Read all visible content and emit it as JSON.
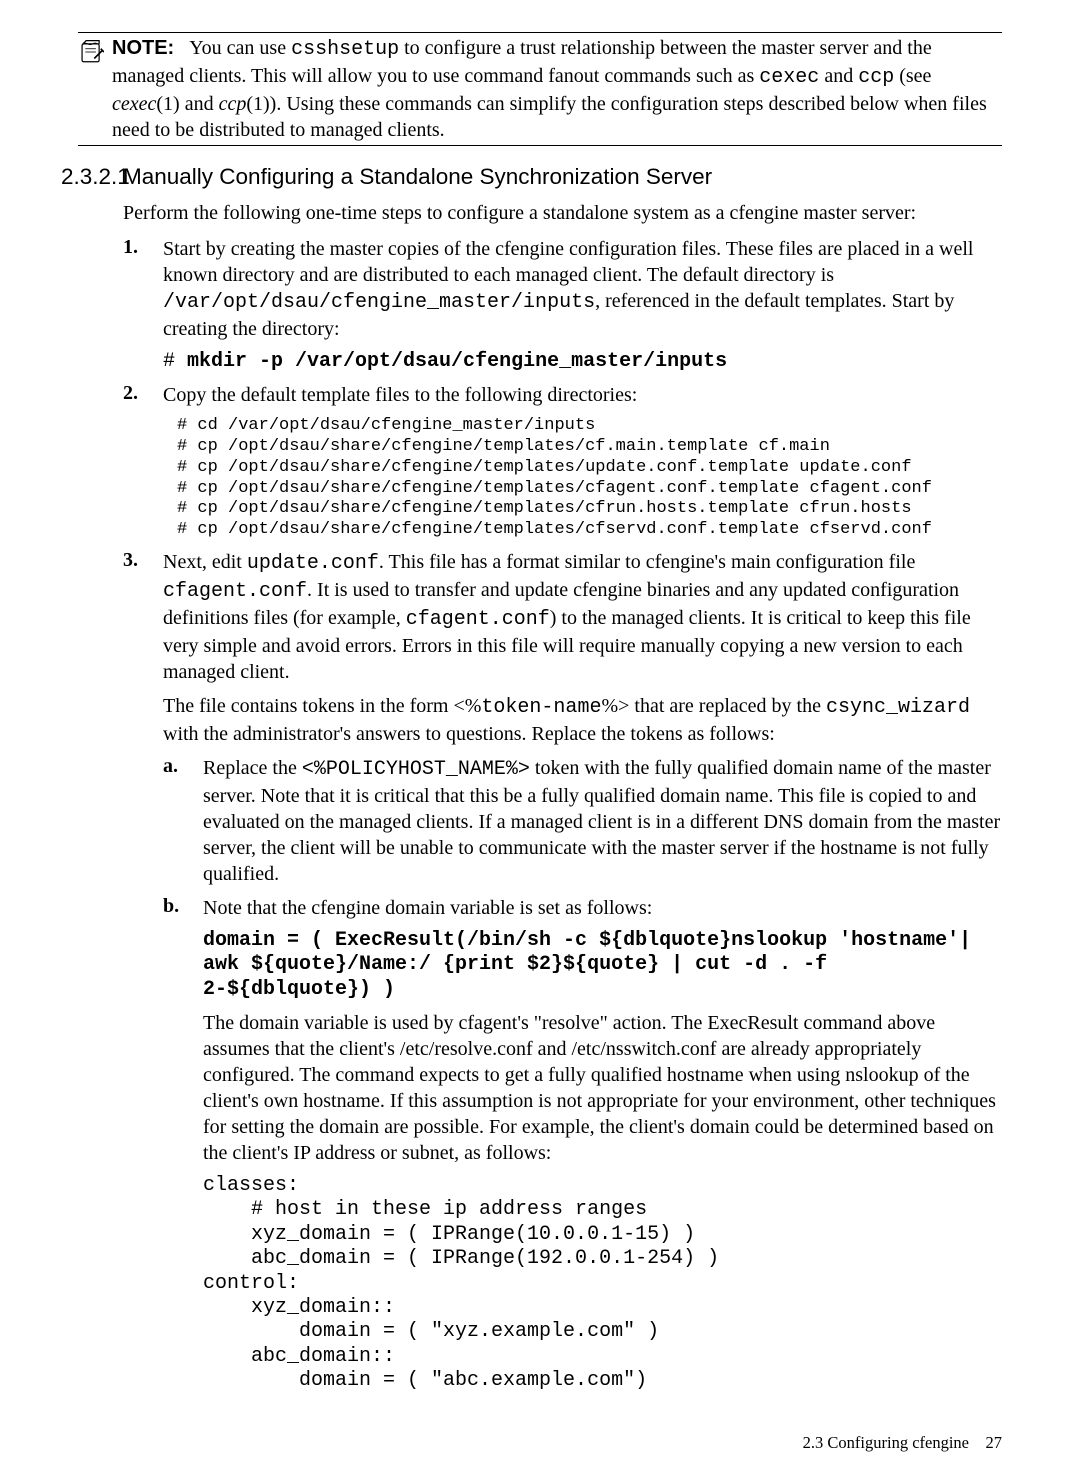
{
  "note": {
    "label": "NOTE:",
    "body_parts": {
      "a": "You can use ",
      "b": " to configure a trust relationship between the master server and the managed clients. This will allow you to use command fanout commands such as ",
      "c": " and ",
      "d": " (see ",
      "e": "(1) and ",
      "f": "(1)). Using these commands can simplify the configuration steps described below when files need to be distributed to managed clients."
    },
    "csshsetup": "csshsetup",
    "cexec_mono": "cexec",
    "ccp_mono": "ccp",
    "cexec_it": "cexec",
    "ccp_it": "ccp"
  },
  "section": {
    "num": "2.3.2.1",
    "title": "Manually Configuring a Standalone Synchronization Server"
  },
  "intro": "Perform the following one-time steps to configure a standalone system as a cfengine master server:",
  "step1": {
    "p1a": "Start by creating the master copies of the cfengine configuration files. These files are placed in a well known directory and are distributed to each managed client. The default directory is ",
    "path": "/var/opt/dsau/cfengine_master/inputs",
    "p1b": ", referenced in the default templates. Start by creating the directory:",
    "cmd_hash": "# ",
    "cmd": "mkdir -p /var/opt/dsau/cfengine_master/inputs"
  },
  "step2": {
    "p": "Copy the default template files to the following directories:",
    "code": "# cd /var/opt/dsau/cfengine_master/inputs\n# cp /opt/dsau/share/cfengine/templates/cf.main.template cf.main\n# cp /opt/dsau/share/cfengine/templates/update.conf.template update.conf\n# cp /opt/dsau/share/cfengine/templates/cfagent.conf.template cfagent.conf\n# cp /opt/dsau/share/cfengine/templates/cfrun.hosts.template cfrun.hosts\n# cp /opt/dsau/share/cfengine/templates/cfservd.conf.template cfservd.conf"
  },
  "step3": {
    "p1a": "Next, edit ",
    "updateconf": "update.conf",
    "p1b": ". This file has a format similar to cfengine's main configuration file ",
    "cfagentconf": "cfagent.conf",
    "p1c": ". It is used to transfer and update cfengine binaries and any updated configuration definitions files (for example, ",
    "p1d": ") to the managed clients. It is critical to keep this file very simple and avoid errors. Errors in this file will require manually copying a new version to each managed client.",
    "p2a": "The file contains tokens in the form <%",
    "tokenname": "token-name",
    "p2b": "%> that are replaced by the ",
    "csync": "csync_wizard",
    "p2c": " with the administrator's answers to questions. Replace the tokens as follows:",
    "a_p1a": "Replace the ",
    "policyhost": "<%POLICYHOST_NAME%>",
    "a_p1b": " token with the fully qualified domain name of the master server. Note that it is critical that this be a fully qualified domain name. This file is copied to and evaluated on the managed clients. If a managed client is in a different DNS domain from the master server, the client will be unable to communicate with the master server if the hostname is not fully qualified.",
    "b_p1": "Note that the cfengine domain variable is set as follows:",
    "b_code": "domain = ( ExecResult(/bin/sh -c ${dblquote}nslookup 'hostname'|\nawk ${quote}/Name:/ {print $2}${quote} | cut -d . -f\n2-${dblquote}) )",
    "b_p2": "The domain variable is used by cfagent's \"resolve\" action. The ExecResult command above assumes that the client's /etc/resolve.conf and /etc/nsswitch.conf are already appropriately configured. The command expects to get a fully qualified hostname when using nslookup of the client's own hostname. If this assumption is not appropriate for your environment, other techniques for setting the domain are possible. For example, the client's domain could be determined based on the client's IP address or subnet, as follows:",
    "b_code2": "classes:\n    # host in these ip address ranges\n    xyz_domain = ( IPRange(10.0.0.1-15) )\n    abc_domain = ( IPRange(192.0.0.1-254) )\ncontrol:\n    xyz_domain::\n        domain = ( \"xyz.example.com\" )\n    abc_domain::\n        domain = ( \"abc.example.com\")"
  },
  "footer": {
    "left": "2.3 Configuring cfengine",
    "page": "27"
  }
}
